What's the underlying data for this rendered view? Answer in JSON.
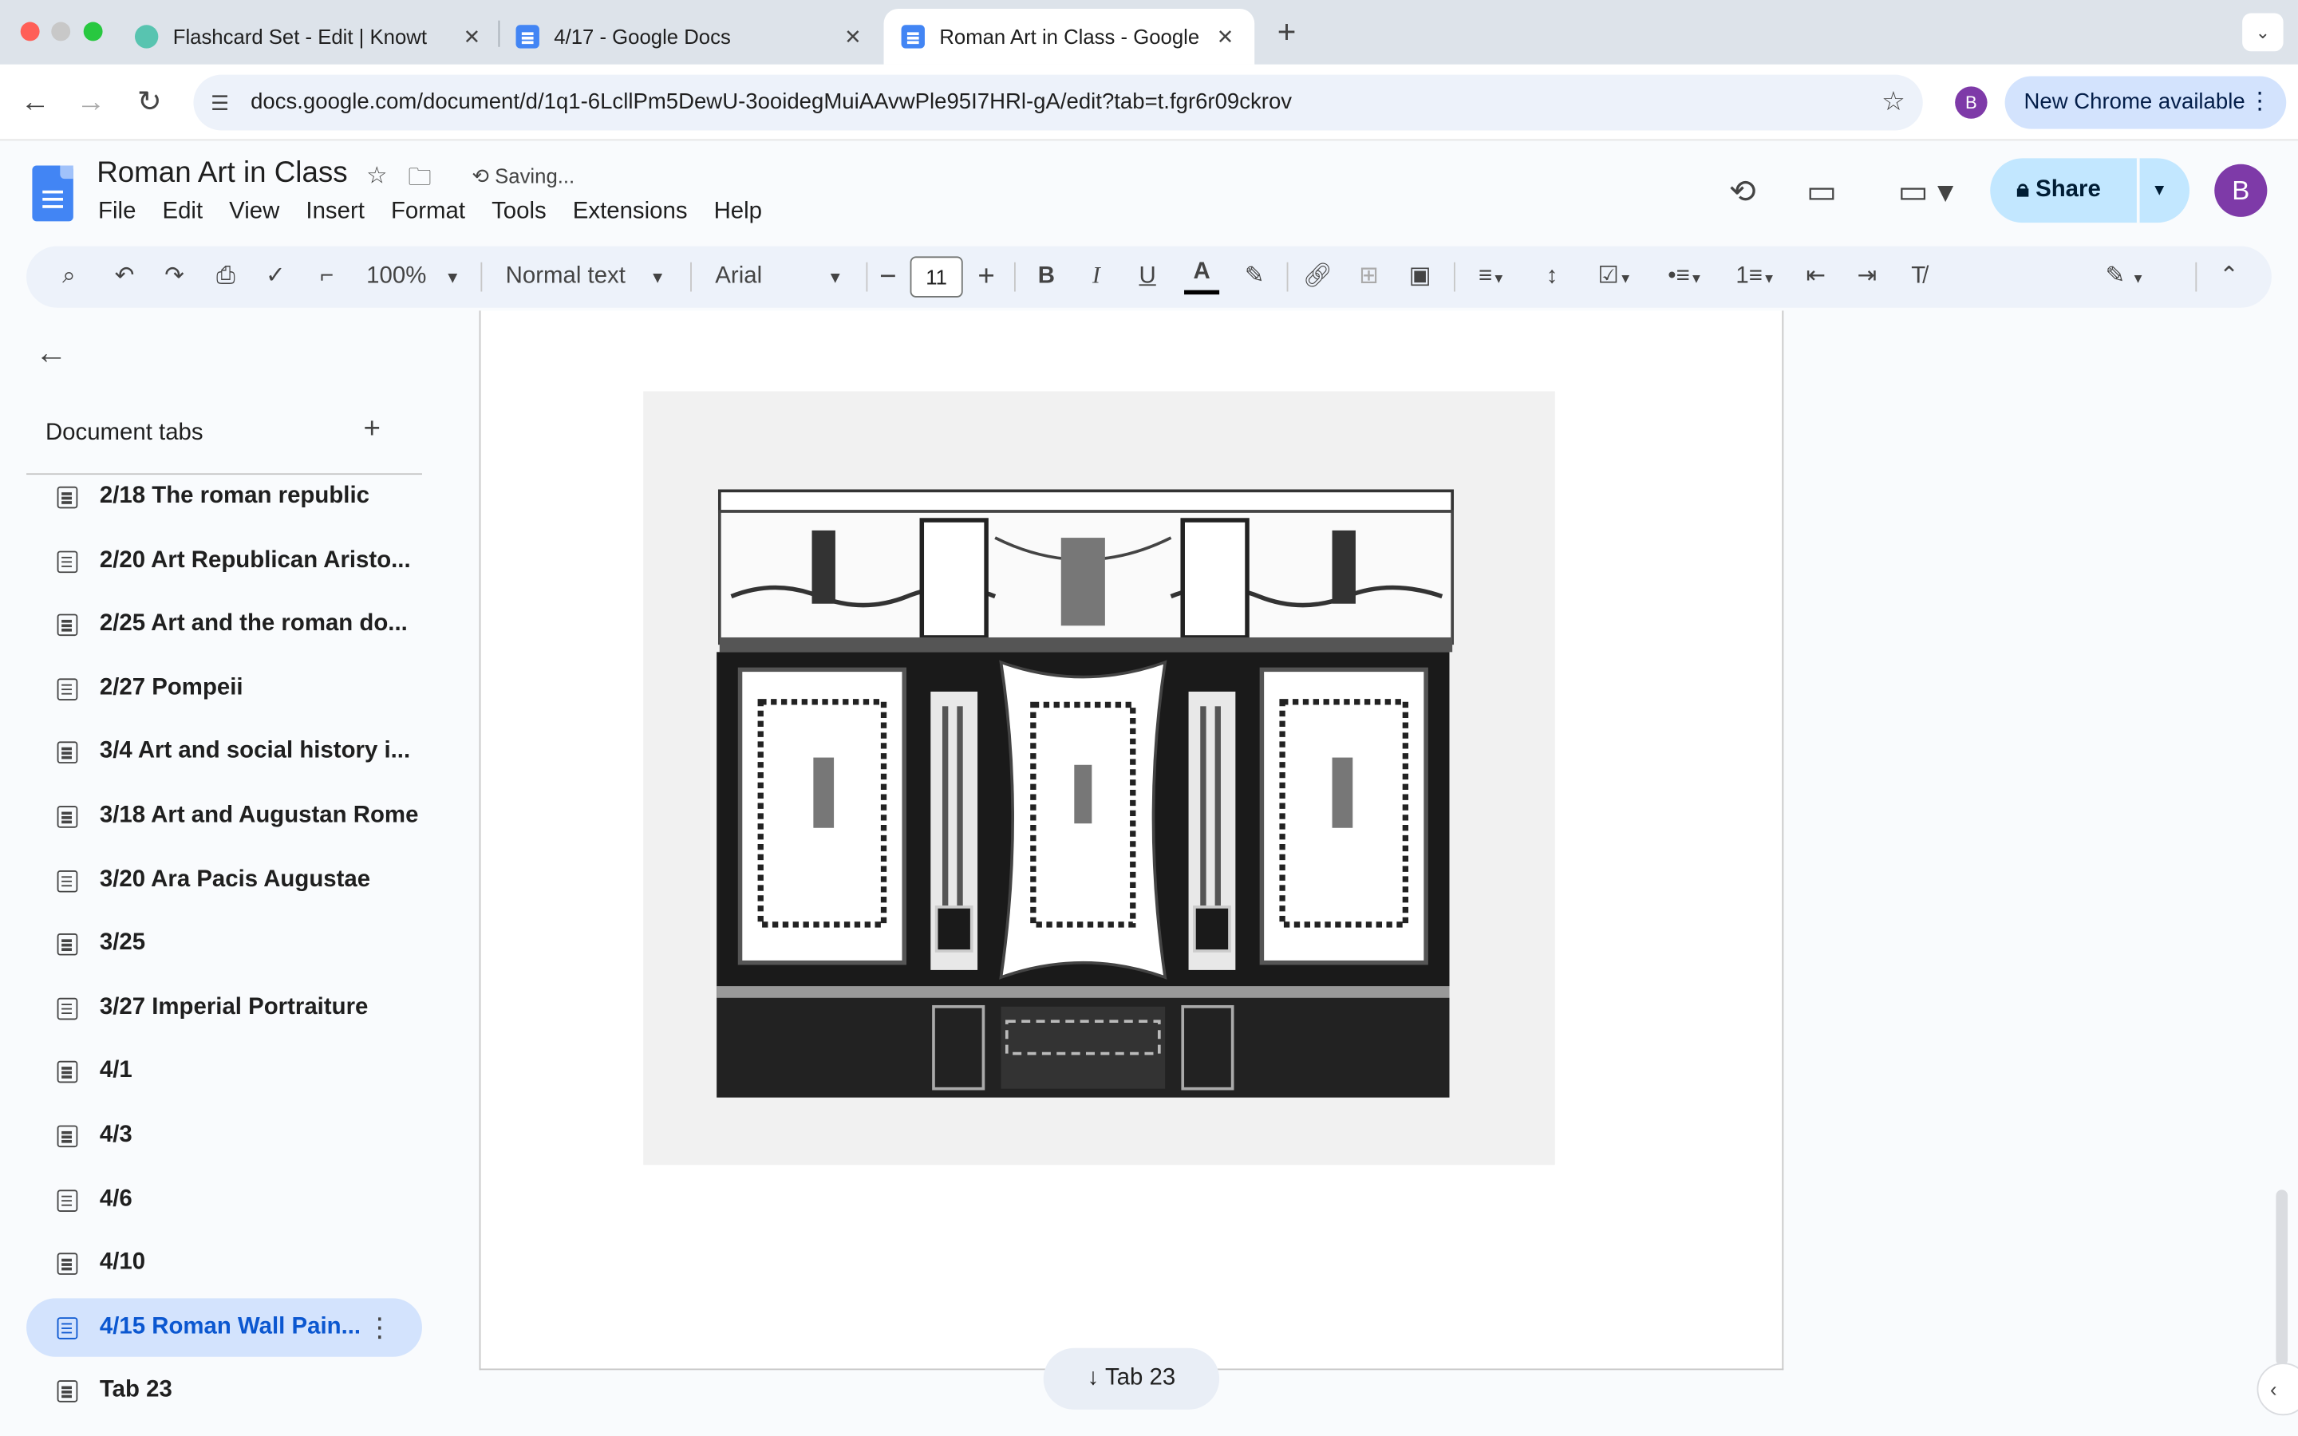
{
  "browser": {
    "tabs": [
      {
        "title": "Flashcard Set - Edit | Knowt",
        "icon": "knowt-icon",
        "active": false
      },
      {
        "title": "4/17 - Google Docs",
        "icon": "docs-icon",
        "active": false
      },
      {
        "title": "Roman Art in Class - Google D",
        "icon": "docs-icon",
        "active": true
      }
    ],
    "url": "docs.google.com/document/d/1q1-6LcllPm5DewU-3ooidegMuiAAvwPle95I7HRl-gA/edit?tab=t.fgr6r09ckrov",
    "profile_initial": "B",
    "new_chrome_label": "New Chrome available"
  },
  "doc": {
    "title": "Roman Art in Class",
    "save_status": "Saving...",
    "menu": [
      "File",
      "Edit",
      "View",
      "Insert",
      "Format",
      "Tools",
      "Extensions",
      "Help"
    ],
    "share_label": "Share",
    "avatar_initial": "B"
  },
  "format_toolbar": {
    "zoom": "100%",
    "style": "Normal text",
    "font": "Arial",
    "font_size": "11"
  },
  "sidebar": {
    "heading": "Document tabs",
    "items": [
      {
        "label": "2/18 The roman republic"
      },
      {
        "label": "2/20 Art Republican Aristo..."
      },
      {
        "label": "2/25 Art and the roman do..."
      },
      {
        "label": "2/27 Pompeii"
      },
      {
        "label": "3/4 Art and social history i..."
      },
      {
        "label": "3/18 Art and Augustan Rome"
      },
      {
        "label": "3/20 Ara Pacis Augustae"
      },
      {
        "label": "3/25"
      },
      {
        "label": "3/27 Imperial Portraiture"
      },
      {
        "label": "4/1"
      },
      {
        "label": "4/3"
      },
      {
        "label": "4/6"
      },
      {
        "label": "4/10"
      },
      {
        "label": "4/15 Roman Wall Pain...",
        "selected": true
      },
      {
        "label": "Tab 23"
      }
    ]
  },
  "canvas": {
    "next_tab_chip": "Tab 23"
  },
  "colors": {
    "accent": "#0b57d0",
    "share_bg": "#c2e7ff",
    "selected_tab_bg": "#d3e3fd",
    "avatar": "#7e3aa8"
  }
}
